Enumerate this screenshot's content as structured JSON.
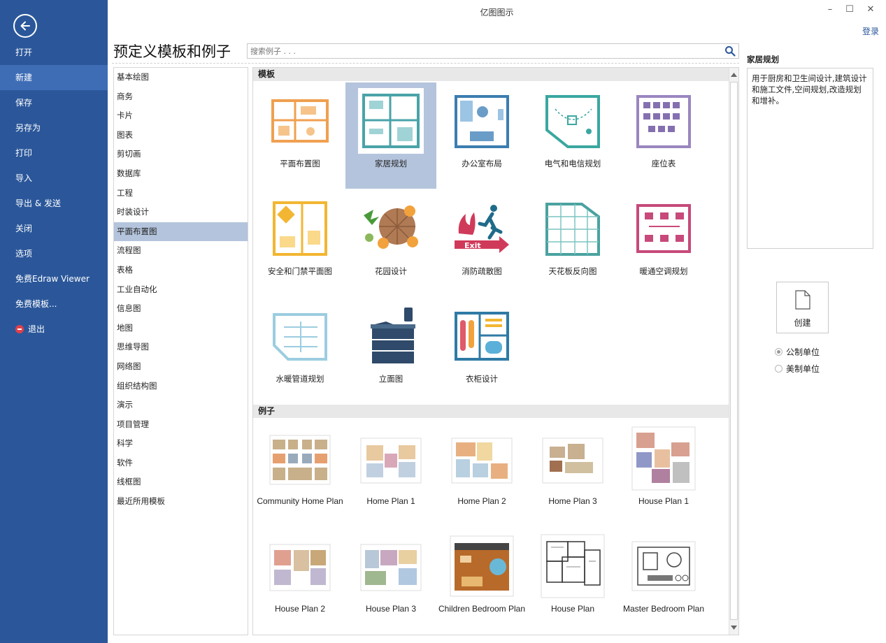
{
  "window": {
    "title": "亿图图示",
    "login": "登录",
    "controls": {
      "minimize": "–",
      "maximize": "☐",
      "close": "✕"
    }
  },
  "sidebar": {
    "items": [
      {
        "label": "打开"
      },
      {
        "label": "新建"
      },
      {
        "label": "保存"
      },
      {
        "label": "另存为"
      },
      {
        "label": "打印"
      },
      {
        "label": "导入"
      },
      {
        "label": "导出 & 发送"
      },
      {
        "label": "关闭"
      },
      {
        "label": "选项"
      },
      {
        "label": "免费Edraw Viewer"
      },
      {
        "label": "免费模板..."
      },
      {
        "label": "退出"
      }
    ],
    "active": "新建"
  },
  "main": {
    "heading": "预定义模板和例子",
    "search_placeholder": "搜索例子 . . ."
  },
  "categories": [
    "基本绘图",
    "商务",
    "卡片",
    "图表",
    "剪切画",
    "数据库",
    "工程",
    "时装设计",
    "平面布置图",
    "流程图",
    "表格",
    "工业自动化",
    "信息图",
    "地图",
    "思维导图",
    "网络图",
    "组织结构图",
    "演示",
    "项目管理",
    "科学",
    "软件",
    "线框图",
    "最近所用模板"
  ],
  "selected_category": "平面布置图",
  "templates": {
    "header": "模板",
    "items": [
      {
        "label": "平面布置图",
        "icon": "floor-plan-icon"
      },
      {
        "label": "家居规划",
        "icon": "home-plan-icon"
      },
      {
        "label": "办公室布局",
        "icon": "office-layout-icon"
      },
      {
        "label": "电气和电信规划",
        "icon": "electrical-plan-icon"
      },
      {
        "label": "座位表",
        "icon": "seating-chart-icon"
      },
      {
        "label": "安全和门禁平面图",
        "icon": "security-plan-icon"
      },
      {
        "label": "花园设计",
        "icon": "garden-design-icon"
      },
      {
        "label": "消防疏散图",
        "icon": "fire-exit-icon"
      },
      {
        "label": "天花板反向图",
        "icon": "ceiling-plan-icon"
      },
      {
        "label": "暖通空调规划",
        "icon": "hvac-plan-icon"
      },
      {
        "label": "水暖管道规划",
        "icon": "plumbing-plan-icon"
      },
      {
        "label": "立面图",
        "icon": "elevation-icon"
      },
      {
        "label": "衣柜设计",
        "icon": "wardrobe-design-icon"
      }
    ],
    "selected": "家居规划"
  },
  "examples": {
    "header": "例子",
    "items": [
      {
        "label": "Community Home Plan"
      },
      {
        "label": "Home Plan 1"
      },
      {
        "label": "Home Plan 2"
      },
      {
        "label": "Home Plan 3"
      },
      {
        "label": "House Plan 1"
      },
      {
        "label": "House Plan 2"
      },
      {
        "label": "House Plan 3"
      },
      {
        "label": "Children Bedroom Plan"
      },
      {
        "label": "House Plan"
      },
      {
        "label": "Master Bedroom Plan"
      }
    ]
  },
  "detail": {
    "title": "家居规划",
    "description": "用于厨房和卫生间设计,建筑设计和施工文件,空间规划,改造规划和增补。",
    "create_label": "创建",
    "units": [
      {
        "label": "公制单位",
        "checked": true
      },
      {
        "label": "美制单位",
        "checked": false
      }
    ]
  },
  "colors": {
    "sidebar_bg": "#2b579a",
    "selected_bg": "#b4c4dc",
    "accent": "#2b579a"
  }
}
